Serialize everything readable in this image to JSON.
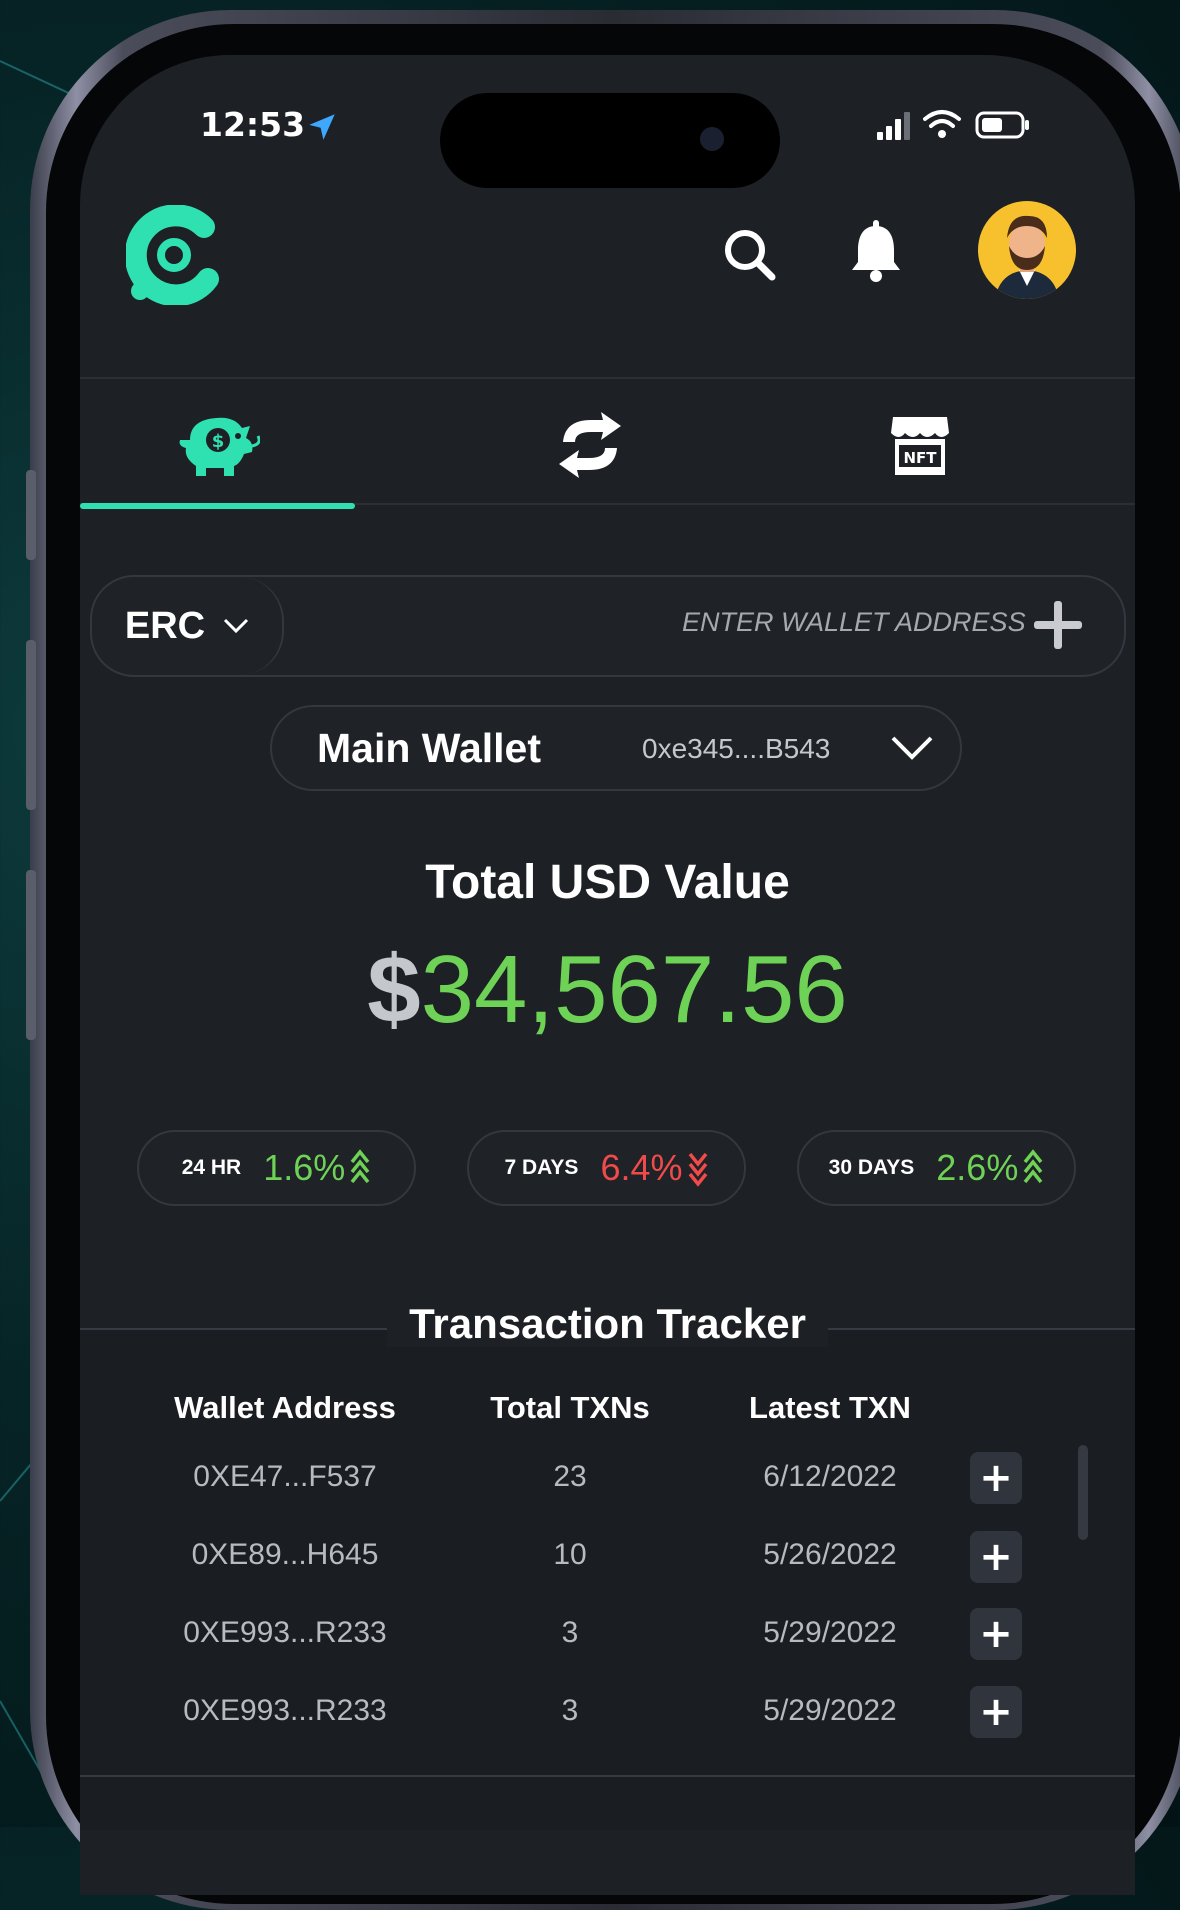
{
  "status_bar": {
    "time": "12:53"
  },
  "header": {
    "logo_icon": "app-logo",
    "search_icon": "search-icon",
    "bell_icon": "bell-icon",
    "avatar_icon": "avatar"
  },
  "tabs": [
    {
      "icon": "piggy-bank-icon",
      "active": true
    },
    {
      "icon": "swap-icon",
      "active": false
    },
    {
      "icon": "nft-store-icon",
      "active": false,
      "badge": "NFT"
    }
  ],
  "network_selector": {
    "value": "ERC"
  },
  "wallet_input": {
    "placeholder": "ENTER WALLET ADDRESS"
  },
  "wallet_selector": {
    "name": "Main Wallet",
    "address": "0xe345....B543"
  },
  "total": {
    "label": "Total USD Value",
    "currency": "$",
    "amount": "34,567.56"
  },
  "changes": [
    {
      "period": "24 HR",
      "value": "1.6%",
      "direction": "up"
    },
    {
      "period": "7 DAYS",
      "value": "6.4%",
      "direction": "down"
    },
    {
      "period": "30 DAYS",
      "value": "2.6%",
      "direction": "up"
    }
  ],
  "tracker": {
    "title": "Transaction Tracker",
    "columns": [
      "Wallet Address",
      "Total TXNs",
      "Latest TXN"
    ],
    "rows": [
      {
        "address": "0XE47...F537",
        "txns": "23",
        "latest": "6/12/2022"
      },
      {
        "address": "0XE89...H645",
        "txns": "10",
        "latest": "5/26/2022"
      },
      {
        "address": "0XE993...R233",
        "txns": "3",
        "latest": "5/29/2022"
      },
      {
        "address": "0XE993...R233",
        "txns": "3",
        "latest": "5/29/2022"
      }
    ]
  },
  "colors": {
    "accent": "#2fe0b0",
    "positive": "#6ed256",
    "negative": "#f04a4a",
    "background": "#1d2024"
  }
}
